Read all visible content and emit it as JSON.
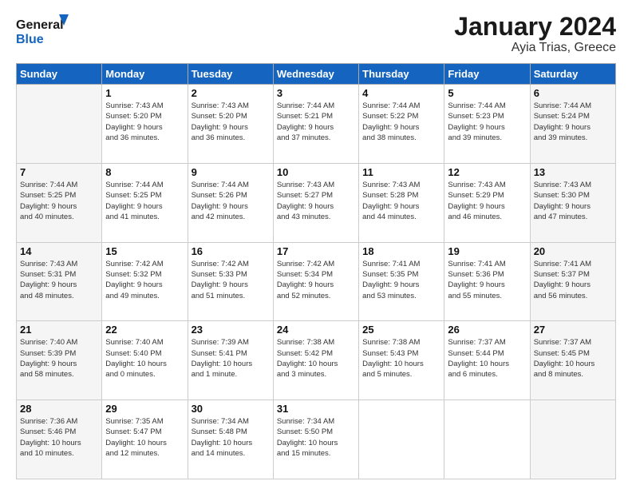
{
  "header": {
    "logo_line1": "General",
    "logo_line2": "Blue",
    "title": "January 2024",
    "subtitle": "Ayia Trias, Greece"
  },
  "days_of_week": [
    "Sunday",
    "Monday",
    "Tuesday",
    "Wednesday",
    "Thursday",
    "Friday",
    "Saturday"
  ],
  "weeks": [
    [
      {
        "day": "",
        "info": ""
      },
      {
        "day": "1",
        "info": "Sunrise: 7:43 AM\nSunset: 5:20 PM\nDaylight: 9 hours\nand 36 minutes."
      },
      {
        "day": "2",
        "info": "Sunrise: 7:43 AM\nSunset: 5:20 PM\nDaylight: 9 hours\nand 36 minutes."
      },
      {
        "day": "3",
        "info": "Sunrise: 7:44 AM\nSunset: 5:21 PM\nDaylight: 9 hours\nand 37 minutes."
      },
      {
        "day": "4",
        "info": "Sunrise: 7:44 AM\nSunset: 5:22 PM\nDaylight: 9 hours\nand 38 minutes."
      },
      {
        "day": "5",
        "info": "Sunrise: 7:44 AM\nSunset: 5:23 PM\nDaylight: 9 hours\nand 39 minutes."
      },
      {
        "day": "6",
        "info": "Sunrise: 7:44 AM\nSunset: 5:24 PM\nDaylight: 9 hours\nand 39 minutes."
      }
    ],
    [
      {
        "day": "7",
        "info": "Sunrise: 7:44 AM\nSunset: 5:25 PM\nDaylight: 9 hours\nand 40 minutes."
      },
      {
        "day": "8",
        "info": "Sunrise: 7:44 AM\nSunset: 5:25 PM\nDaylight: 9 hours\nand 41 minutes."
      },
      {
        "day": "9",
        "info": "Sunrise: 7:44 AM\nSunset: 5:26 PM\nDaylight: 9 hours\nand 42 minutes."
      },
      {
        "day": "10",
        "info": "Sunrise: 7:43 AM\nSunset: 5:27 PM\nDaylight: 9 hours\nand 43 minutes."
      },
      {
        "day": "11",
        "info": "Sunrise: 7:43 AM\nSunset: 5:28 PM\nDaylight: 9 hours\nand 44 minutes."
      },
      {
        "day": "12",
        "info": "Sunrise: 7:43 AM\nSunset: 5:29 PM\nDaylight: 9 hours\nand 46 minutes."
      },
      {
        "day": "13",
        "info": "Sunrise: 7:43 AM\nSunset: 5:30 PM\nDaylight: 9 hours\nand 47 minutes."
      }
    ],
    [
      {
        "day": "14",
        "info": "Sunrise: 7:43 AM\nSunset: 5:31 PM\nDaylight: 9 hours\nand 48 minutes."
      },
      {
        "day": "15",
        "info": "Sunrise: 7:42 AM\nSunset: 5:32 PM\nDaylight: 9 hours\nand 49 minutes."
      },
      {
        "day": "16",
        "info": "Sunrise: 7:42 AM\nSunset: 5:33 PM\nDaylight: 9 hours\nand 51 minutes."
      },
      {
        "day": "17",
        "info": "Sunrise: 7:42 AM\nSunset: 5:34 PM\nDaylight: 9 hours\nand 52 minutes."
      },
      {
        "day": "18",
        "info": "Sunrise: 7:41 AM\nSunset: 5:35 PM\nDaylight: 9 hours\nand 53 minutes."
      },
      {
        "day": "19",
        "info": "Sunrise: 7:41 AM\nSunset: 5:36 PM\nDaylight: 9 hours\nand 55 minutes."
      },
      {
        "day": "20",
        "info": "Sunrise: 7:41 AM\nSunset: 5:37 PM\nDaylight: 9 hours\nand 56 minutes."
      }
    ],
    [
      {
        "day": "21",
        "info": "Sunrise: 7:40 AM\nSunset: 5:39 PM\nDaylight: 9 hours\nand 58 minutes."
      },
      {
        "day": "22",
        "info": "Sunrise: 7:40 AM\nSunset: 5:40 PM\nDaylight: 10 hours\nand 0 minutes."
      },
      {
        "day": "23",
        "info": "Sunrise: 7:39 AM\nSunset: 5:41 PM\nDaylight: 10 hours\nand 1 minute."
      },
      {
        "day": "24",
        "info": "Sunrise: 7:38 AM\nSunset: 5:42 PM\nDaylight: 10 hours\nand 3 minutes."
      },
      {
        "day": "25",
        "info": "Sunrise: 7:38 AM\nSunset: 5:43 PM\nDaylight: 10 hours\nand 5 minutes."
      },
      {
        "day": "26",
        "info": "Sunrise: 7:37 AM\nSunset: 5:44 PM\nDaylight: 10 hours\nand 6 minutes."
      },
      {
        "day": "27",
        "info": "Sunrise: 7:37 AM\nSunset: 5:45 PM\nDaylight: 10 hours\nand 8 minutes."
      }
    ],
    [
      {
        "day": "28",
        "info": "Sunrise: 7:36 AM\nSunset: 5:46 PM\nDaylight: 10 hours\nand 10 minutes."
      },
      {
        "day": "29",
        "info": "Sunrise: 7:35 AM\nSunset: 5:47 PM\nDaylight: 10 hours\nand 12 minutes."
      },
      {
        "day": "30",
        "info": "Sunrise: 7:34 AM\nSunset: 5:48 PM\nDaylight: 10 hours\nand 14 minutes."
      },
      {
        "day": "31",
        "info": "Sunrise: 7:34 AM\nSunset: 5:50 PM\nDaylight: 10 hours\nand 15 minutes."
      },
      {
        "day": "",
        "info": ""
      },
      {
        "day": "",
        "info": ""
      },
      {
        "day": "",
        "info": ""
      }
    ]
  ]
}
